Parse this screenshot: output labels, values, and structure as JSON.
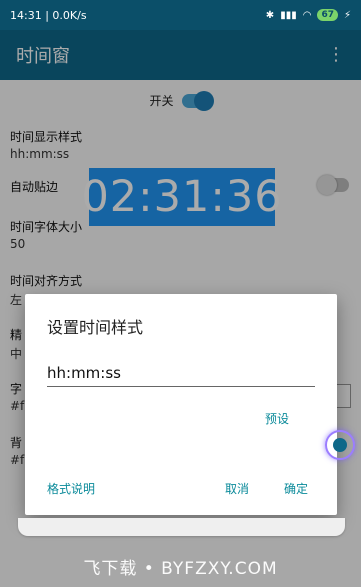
{
  "status_bar": {
    "left_text": "14:31 | 0.0K/s",
    "battery": "67"
  },
  "app_bar": {
    "title": "时间窗"
  },
  "settings": {
    "toggle_label": "开关",
    "time_style_label": "时间显示样式",
    "time_style_value": "hh:mm:ss",
    "auto_snap_label": "自动贴边",
    "font_size_label": "时间字体大小",
    "font_size_value": "50",
    "align_label": "时间对齐方式",
    "align_value": "左",
    "precision_label": "精",
    "precision_value": "中",
    "font_color_label": "字",
    "font_color_value": "#f",
    "bg_label": "背",
    "bg_value": "#f"
  },
  "clock_display": "02:31:36",
  "dialog": {
    "title": "设置时间样式",
    "input_value": "hh:mm:ss",
    "preset_button": "预设",
    "format_help_button": "格式说明",
    "cancel_button": "取消",
    "ok_button": "确定"
  },
  "watermark": "飞下载 • BYFZXY.COM"
}
